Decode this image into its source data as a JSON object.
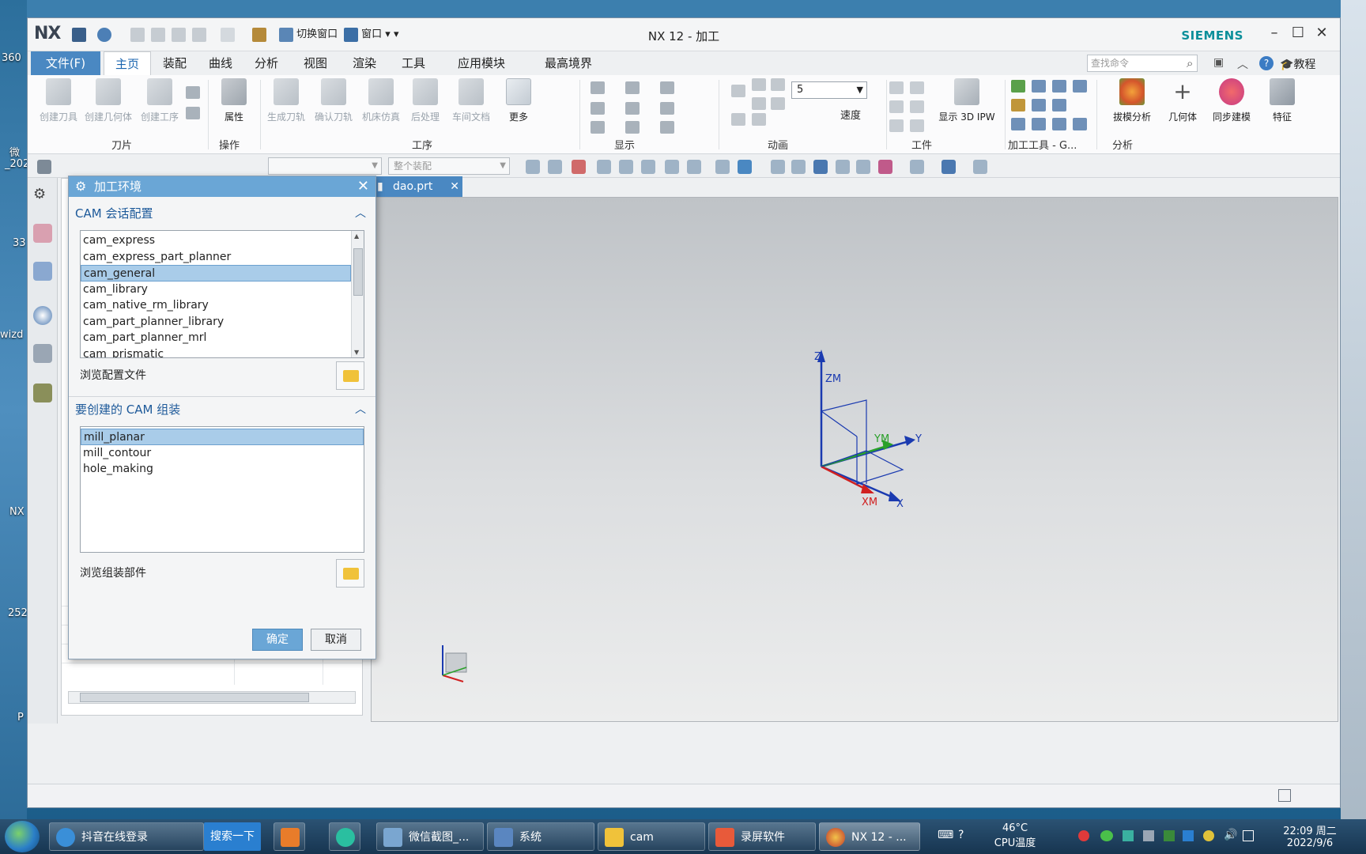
{
  "desktop": {
    "labels": [
      "360",
      "微",
      "_202",
      "33",
      "wizd",
      "NX",
      "252",
      "P"
    ]
  },
  "window": {
    "title": "NX 12 - 加工",
    "brand": "SIEMENS",
    "logo": "NX",
    "quick_access": [
      "切换窗口",
      "窗口"
    ],
    "controls": [
      "minimize",
      "maximize",
      "close"
    ]
  },
  "tabs": [
    {
      "label": "文件(F)"
    },
    {
      "label": "主页"
    },
    {
      "label": "装配"
    },
    {
      "label": "曲线"
    },
    {
      "label": "分析"
    },
    {
      "label": "视图"
    },
    {
      "label": "渲染"
    },
    {
      "label": "工具"
    },
    {
      "label": "应用模块"
    },
    {
      "label": "最高境界"
    }
  ],
  "search": {
    "placeholder": "查找命令"
  },
  "help_label": "教程",
  "ribbon": {
    "buttons": [
      {
        "label": "创建刀具"
      },
      {
        "label": "创建几何体"
      },
      {
        "label": "创建工序"
      },
      {
        "label": "属性"
      },
      {
        "label": "生成刀轨"
      },
      {
        "label": "确认刀轨"
      },
      {
        "label": "机床仿真"
      },
      {
        "label": "后处理"
      },
      {
        "label": "车间文档"
      },
      {
        "label": "更多"
      },
      {
        "label": "速度"
      },
      {
        "label": "显示 3D IPW"
      },
      {
        "label": "拔模分析"
      },
      {
        "label": "几何体"
      },
      {
        "label": "同步建模"
      },
      {
        "label": "特征"
      }
    ],
    "speed_value": "5",
    "groups": [
      {
        "label": "刀片"
      },
      {
        "label": "操作"
      },
      {
        "label": "工序"
      },
      {
        "label": "显示"
      },
      {
        "label": "动画"
      },
      {
        "label": "工件"
      },
      {
        "label": "加工工具 - G..."
      },
      {
        "label": "分析"
      }
    ]
  },
  "toolbar2": {
    "assembly_combo": "整个装配"
  },
  "graphics": {
    "tab_label": "dao.prt",
    "axes": {
      "z": "Z",
      "zm": "ZM",
      "ym": "YM",
      "y": "Y",
      "xm": "XM",
      "x": "X"
    }
  },
  "dialog": {
    "title": "加工环境",
    "section1": {
      "title": "CAM 会话配置",
      "items": [
        "cam_express",
        "cam_express_part_planner",
        "cam_general",
        "cam_library",
        "cam_native_rm_library",
        "cam_part_planner_library",
        "cam_part_planner_mrl",
        "cam_prismatic"
      ],
      "selected": "cam_general",
      "browse_label": "浏览配置文件"
    },
    "section2": {
      "title": "要创建的 CAM 组装",
      "items": [
        "mill_planar",
        "mill_contour",
        "hole_making"
      ],
      "selected": "mill_planar",
      "browse_label": "浏览组装部件"
    },
    "ok_label": "确定",
    "cancel_label": "取消"
  },
  "taskbar": {
    "items": [
      {
        "label": "抖音在线登录"
      },
      {
        "label": "搜索一下"
      },
      {
        "label": "微信截图_..."
      },
      {
        "label": "系统"
      },
      {
        "label": "cam"
      },
      {
        "label": "录屏软件"
      },
      {
        "label": "NX 12 - ..."
      }
    ],
    "temp": "46°C",
    "temp_label": "CPU温度",
    "time": "22:09 周二",
    "date": "2022/9/6"
  },
  "colors": {
    "accent": "#4a88c2",
    "dialog_title": "#6aa6d6",
    "selection": "#a9cce9",
    "brand": "#0b8f9a"
  }
}
